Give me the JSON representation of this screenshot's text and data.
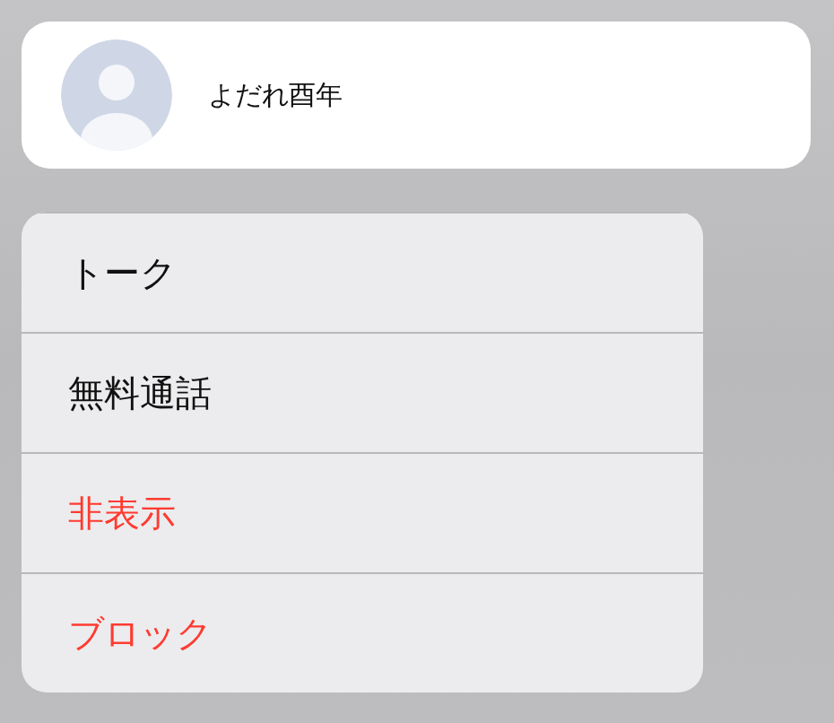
{
  "contact": {
    "name": "よだれ酉年"
  },
  "menu": [
    {
      "label": "トーク",
      "kind": "default"
    },
    {
      "label": "無料通話",
      "kind": "default"
    },
    {
      "label": "非表示",
      "kind": "destructive"
    },
    {
      "label": "ブロック",
      "kind": "destructive"
    }
  ]
}
